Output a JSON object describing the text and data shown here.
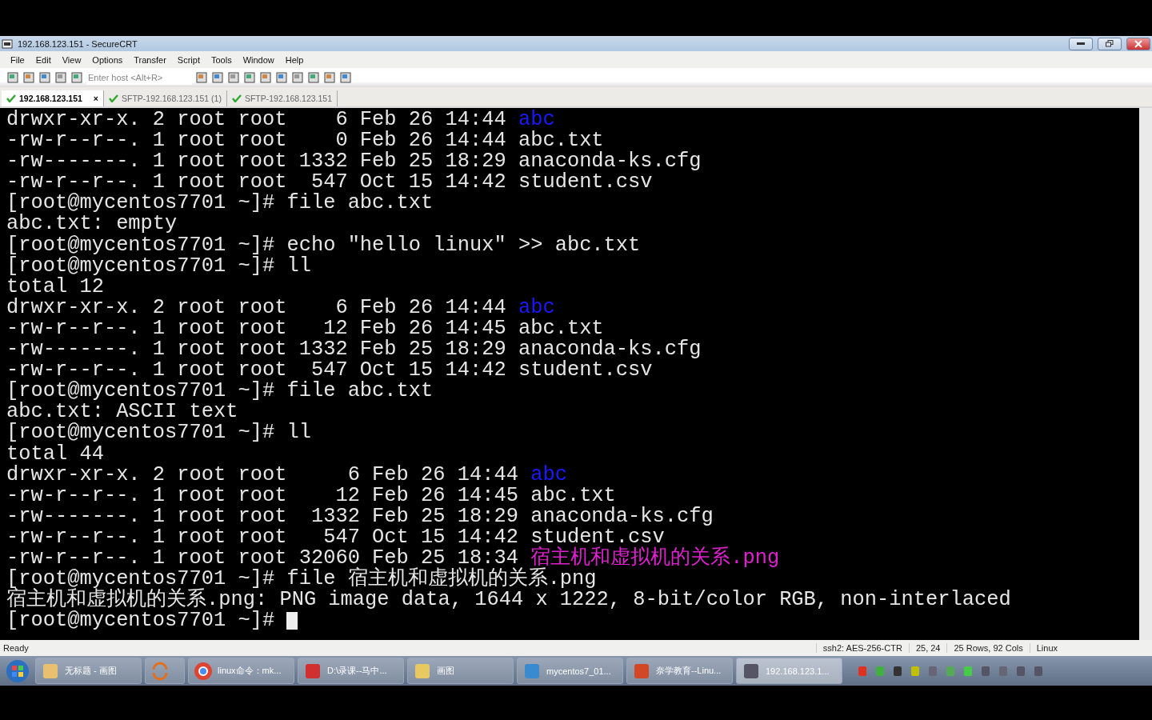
{
  "window": {
    "title": "192.168.123.151 - SecureCRT"
  },
  "menu": [
    "File",
    "Edit",
    "View",
    "Options",
    "Transfer",
    "Script",
    "Tools",
    "Window",
    "Help"
  ],
  "toolbar": {
    "host_placeholder": "Enter host <Alt+R>"
  },
  "tabs": [
    {
      "label": "192.168.123.151",
      "selected": true,
      "close": "×"
    },
    {
      "label": "SFTP-192.168.123.151 (1)",
      "selected": false
    },
    {
      "label": "SFTP-192.168.123.151",
      "selected": false
    }
  ],
  "terminal": {
    "lines": [
      {
        "cursor": false,
        "segments": [
          {
            "kind": "plain",
            "text": "drwxr-xr-x. 2 root root    6 Feb 26 14:44 "
          },
          {
            "kind": "dir",
            "text": "abc"
          }
        ]
      },
      {
        "cursor": false,
        "segments": [
          {
            "kind": "plain",
            "text": "-rw-r--r--. 1 root root    0 Feb 26 14:44 abc.txt"
          }
        ]
      },
      {
        "cursor": false,
        "segments": [
          {
            "kind": "plain",
            "text": "-rw-------. 1 root root 1332 Feb 25 18:29 anaconda-ks.cfg"
          }
        ]
      },
      {
        "cursor": false,
        "segments": [
          {
            "kind": "plain",
            "text": "-rw-r--r--. 1 root root  547 Oct 15 14:42 student.csv"
          }
        ]
      },
      {
        "cursor": false,
        "segments": [
          {
            "kind": "plain",
            "text": "[root@mycentos7701 ~]# file abc.txt"
          }
        ]
      },
      {
        "cursor": false,
        "segments": [
          {
            "kind": "plain",
            "text": "abc.txt: empty"
          }
        ]
      },
      {
        "cursor": false,
        "segments": [
          {
            "kind": "plain",
            "text": "[root@mycentos7701 ~]# echo \"hello linux\" >> abc.txt"
          }
        ]
      },
      {
        "cursor": false,
        "segments": [
          {
            "kind": "plain",
            "text": "[root@mycentos7701 ~]# ll"
          }
        ]
      },
      {
        "cursor": false,
        "segments": [
          {
            "kind": "plain",
            "text": "total 12"
          }
        ]
      },
      {
        "cursor": false,
        "segments": [
          {
            "kind": "plain",
            "text": "drwxr-xr-x. 2 root root    6 Feb 26 14:44 "
          },
          {
            "kind": "dir",
            "text": "abc"
          }
        ]
      },
      {
        "cursor": false,
        "segments": [
          {
            "kind": "plain",
            "text": "-rw-r--r--. 1 root root   12 Feb 26 14:45 abc.txt"
          }
        ]
      },
      {
        "cursor": false,
        "segments": [
          {
            "kind": "plain",
            "text": "-rw-------. 1 root root 1332 Feb 25 18:29 anaconda-ks.cfg"
          }
        ]
      },
      {
        "cursor": false,
        "segments": [
          {
            "kind": "plain",
            "text": "-rw-r--r--. 1 root root  547 Oct 15 14:42 student.csv"
          }
        ]
      },
      {
        "cursor": false,
        "segments": [
          {
            "kind": "plain",
            "text": "[root@mycentos7701 ~]# file abc.txt"
          }
        ]
      },
      {
        "cursor": false,
        "segments": [
          {
            "kind": "plain",
            "text": "abc.txt: ASCII text"
          }
        ]
      },
      {
        "cursor": false,
        "segments": [
          {
            "kind": "plain",
            "text": "[root@mycentos7701 ~]# ll"
          }
        ]
      },
      {
        "cursor": false,
        "segments": [
          {
            "kind": "plain",
            "text": "total 44"
          }
        ]
      },
      {
        "cursor": false,
        "segments": [
          {
            "kind": "plain",
            "text": "drwxr-xr-x. 2 root root     6 Feb 26 14:44 "
          },
          {
            "kind": "dir",
            "text": "abc"
          }
        ]
      },
      {
        "cursor": false,
        "segments": [
          {
            "kind": "plain",
            "text": "-rw-r--r--. 1 root root    12 Feb 26 14:45 abc.txt"
          }
        ]
      },
      {
        "cursor": false,
        "segments": [
          {
            "kind": "plain",
            "text": "-rw-------. 1 root root  1332 Feb 25 18:29 anaconda-ks.cfg"
          }
        ]
      },
      {
        "cursor": false,
        "segments": [
          {
            "kind": "plain",
            "text": "-rw-r--r--. 1 root root   547 Oct 15 14:42 student.csv"
          }
        ]
      },
      {
        "cursor": false,
        "segments": [
          {
            "kind": "plain",
            "text": "-rw-r--r--. 1 root root 32060 Feb 25 18:34 "
          },
          {
            "kind": "image",
            "text": "宿主机和虚拟机的关系.png"
          }
        ]
      },
      {
        "cursor": false,
        "segments": [
          {
            "kind": "plain",
            "text": "[root@mycentos7701 ~]# file 宿主机和虚拟机的关系.png"
          }
        ]
      },
      {
        "cursor": false,
        "segments": [
          {
            "kind": "plain",
            "text": "宿主机和虚拟机的关系.png: PNG image data, 1644 x 1222, 8-bit/color RGB, non-interlaced"
          }
        ]
      },
      {
        "cursor": true,
        "segments": [
          {
            "kind": "plain",
            "text": "[root@mycentos7701 ~]# "
          }
        ]
      }
    ]
  },
  "status_bar": [
    "Ready",
    "ssh2: AES-256-CTR",
    "25,  24",
    "25 Rows, 92 Cols",
    "Linux"
  ],
  "taskbar": [
    {
      "label": "无标题 - 画图",
      "selected": false
    },
    {
      "selected": false
    },
    {
      "label": "linux命令：mk...",
      "selected": false
    },
    {
      "label": "D:\\录课--马中...",
      "selected": false
    },
    {
      "label": "画图",
      "selected": false
    },
    {
      "label": "mycentos7_01...",
      "selected": false
    },
    {
      "label": "奈学教育--Linu...",
      "selected": false
    },
    {
      "label": "192.168.123.1...",
      "selected": true
    }
  ]
}
